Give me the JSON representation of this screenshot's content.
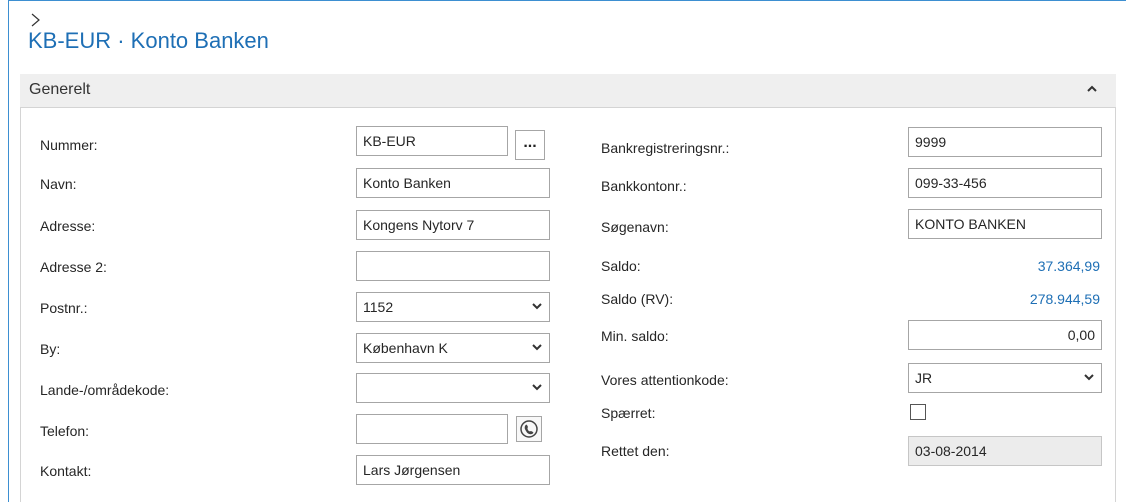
{
  "page": {
    "title": "KB-EUR · Konto Banken"
  },
  "section": {
    "title": "Generelt",
    "collapse_icon": "chevron-up-icon"
  },
  "left": {
    "nummer": {
      "label": "Nummer:",
      "value": "KB-EUR",
      "lookup_label": "..."
    },
    "navn": {
      "label": "Navn:",
      "value": "Konto Banken"
    },
    "adresse": {
      "label": "Adresse:",
      "value": "Kongens Nytorv 7"
    },
    "adresse2": {
      "label": "Adresse 2:",
      "value": ""
    },
    "postnr": {
      "label": "Postnr.:",
      "value": "1152"
    },
    "by": {
      "label": "By:",
      "value": "København K"
    },
    "lande": {
      "label": "Lande-/områdekode:",
      "value": ""
    },
    "telefon": {
      "label": "Telefon:",
      "value": ""
    },
    "kontakt": {
      "label": "Kontakt:",
      "value": "Lars Jørgensen"
    }
  },
  "right": {
    "bankreg": {
      "label": "Bankregistreringsnr.:",
      "value": "9999"
    },
    "bankkonto": {
      "label": "Bankkontonr.:",
      "value": "099-33-456"
    },
    "soegenavn": {
      "label": "Søgenavn:",
      "value": "KONTO BANKEN"
    },
    "saldo": {
      "label": "Saldo:",
      "value": "37.364,99"
    },
    "saldo_rv": {
      "label": "Saldo (RV):",
      "value": "278.944,59"
    },
    "min_saldo": {
      "label": "Min. saldo:",
      "value": "0,00"
    },
    "attention": {
      "label": "Vores attentionkode:",
      "value": "JR"
    },
    "spaerret": {
      "label": "Spærret:",
      "checked": false
    },
    "rettet": {
      "label": "Rettet den:",
      "value": "03-08-2014"
    }
  },
  "colors": {
    "accent": "#1e6fb5",
    "border": "#3d8fd1"
  }
}
